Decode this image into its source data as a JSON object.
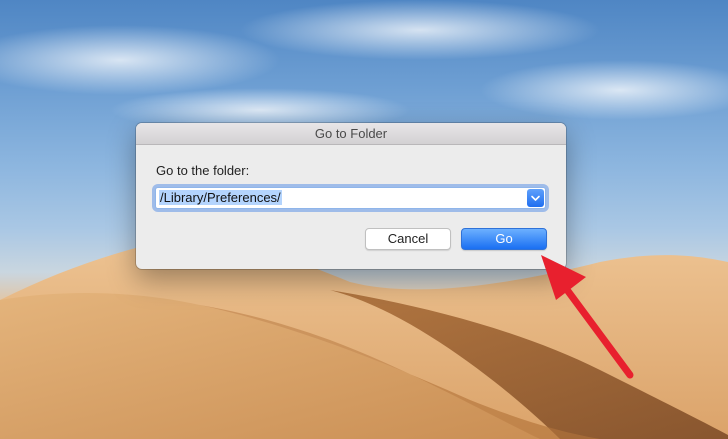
{
  "dialog": {
    "title": "Go to Folder",
    "prompt": "Go to the folder:",
    "path_value": "/Library/Preferences/",
    "cancel_label": "Cancel",
    "go_label": "Go"
  },
  "colors": {
    "accent": "#1a6ff2",
    "annotation_arrow": "#e8202e"
  }
}
